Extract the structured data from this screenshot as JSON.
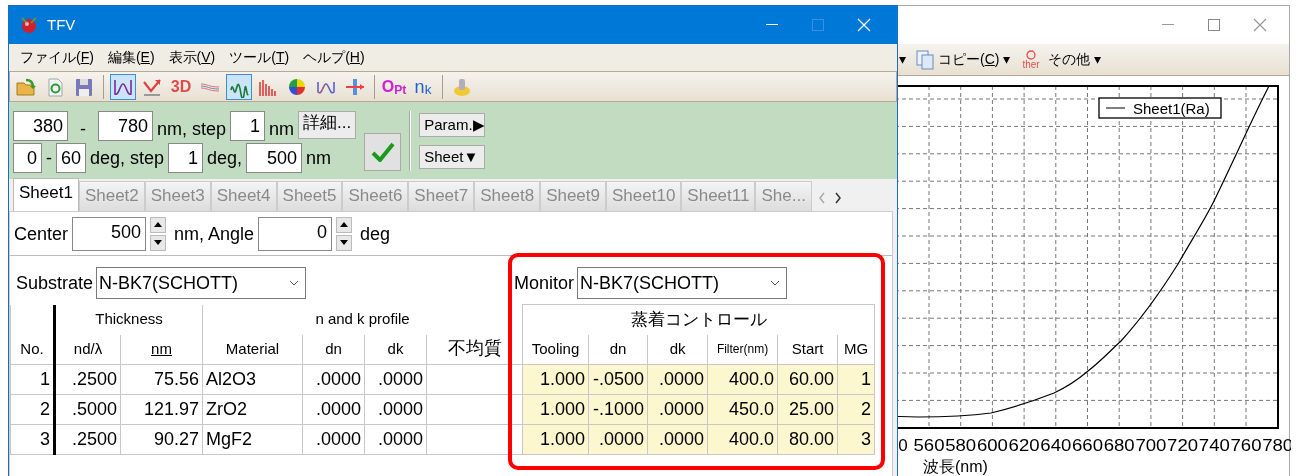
{
  "window": {
    "title": "TFV"
  },
  "menu": [
    {
      "label": "ファイル(F)"
    },
    {
      "label": "編集(E)"
    },
    {
      "label": "表示(V)"
    },
    {
      "label": "ツール(T)"
    },
    {
      "label": "ヘルプ(H)"
    }
  ],
  "toolbar": [
    {
      "kind": "open",
      "pressed": false
    },
    {
      "kind": "reload",
      "pressed": false
    },
    {
      "kind": "save",
      "pressed": false
    },
    {
      "kind": "separator"
    },
    {
      "kind": "wave",
      "pressed": true
    },
    {
      "kind": "arrow",
      "pressed": false
    },
    {
      "kind": "threed",
      "text": "3D",
      "pressed": false
    },
    {
      "kind": "lines",
      "pressed": false
    },
    {
      "kind": "spectrum",
      "pressed": true
    },
    {
      "kind": "bars",
      "pressed": false
    },
    {
      "kind": "colorwheel",
      "pressed": false
    },
    {
      "kind": "wave2",
      "pressed": false
    },
    {
      "kind": "split",
      "pressed": false
    },
    {
      "kind": "separator"
    },
    {
      "kind": "opt",
      "text": "O$_{Pt}$",
      "pressed": false
    },
    {
      "kind": "nk",
      "text": "n$_{k}$",
      "pressed": false
    },
    {
      "kind": "separator"
    },
    {
      "kind": "stamp",
      "pressed": false
    }
  ],
  "range": {
    "wl_from": "380",
    "wl_dash": "-",
    "wl_to": "780",
    "wl_step_label": "nm, step",
    "wl_step": "1",
    "wl_unit": "nm",
    "detail_button": "詳細...",
    "ang_from": "0",
    "ang_dash": "-",
    "ang_to": "60",
    "ang_step_label": "deg, step",
    "ang_step": "1",
    "ang_unit": "deg,",
    "ref_wl": "500",
    "ref_unit": "nm",
    "param_button": "Param.▶",
    "sheet_button": "Sheet▼"
  },
  "tabs": [
    {
      "label": "Sheet1",
      "selected": true
    },
    {
      "label": "Sheet2",
      "selected": false
    },
    {
      "label": "Sheet3",
      "selected": false
    },
    {
      "label": "Sheet4",
      "selected": false
    },
    {
      "label": "Sheet5",
      "selected": false
    },
    {
      "label": "Sheet6",
      "selected": false
    },
    {
      "label": "Sheet7",
      "selected": false
    },
    {
      "label": "Sheet8",
      "selected": false
    },
    {
      "label": "Sheet9",
      "selected": false
    },
    {
      "label": "Sheet10",
      "selected": false
    },
    {
      "label": "Sheet11",
      "selected": false
    },
    {
      "label": "She...",
      "selected": false
    }
  ],
  "center": {
    "label": "Center",
    "value": "500",
    "unit": "nm, Angle",
    "angle": "0",
    "angle_unit": "deg"
  },
  "substrate": {
    "label": "Substrate",
    "value": "N-BK7(SCHOTT)"
  },
  "monitor": {
    "label": "Monitor",
    "value": "N-BK7(SCHOTT)"
  },
  "layers": {
    "groups": [
      {
        "control": false,
        "columns": [
          {
            "label": "No.",
            "underline": false
          }
        ]
      },
      {
        "label": "Thickness",
        "control": false,
        "columns": [
          {
            "label": "nd/λ",
            "underline": false
          },
          {
            "label": "nm",
            "underline": true
          }
        ]
      },
      {
        "label": "n and k profile",
        "control": false,
        "columns": [
          {
            "label": "Material",
            "underline": false
          },
          {
            "label": "dn",
            "underline": false
          },
          {
            "label": "dk",
            "underline": false
          },
          {
            "label": "不均質",
            "underline": false
          }
        ]
      },
      {
        "label": "蒸着コントロール",
        "control": true,
        "columns": [
          {
            "label": "Tooling",
            "underline": false
          },
          {
            "label": "dn",
            "underline": false
          },
          {
            "label": "dk",
            "underline": false
          },
          {
            "label": "Filter(nm)",
            "underline": false
          },
          {
            "label": "Start",
            "underline": false
          },
          {
            "label": "MG",
            "underline": false
          }
        ]
      }
    ],
    "rows": [
      {
        "no": "1",
        "nd": ".2500",
        "nm": "75.56",
        "material": "Al2O3",
        "dn": ".0000",
        "dk": ".0000",
        "tooling": "1.000",
        "cdn": "-.0500",
        "cdk": ".0000",
        "filter": "400.0",
        "start": "60.00",
        "mg": "1"
      },
      {
        "no": "2",
        "nd": ".5000",
        "nm": "121.97",
        "material": "ZrO2",
        "dn": ".0000",
        "dk": ".0000",
        "tooling": "1.000",
        "cdn": "-.1000",
        "cdk": ".0000",
        "filter": "450.0",
        "start": "25.00",
        "mg": "2"
      },
      {
        "no": "3",
        "nd": ".2500",
        "nm": "90.27",
        "material": "MgF2",
        "dn": ".0000",
        "dk": ".0000",
        "tooling": "1.000",
        "cdn": ".0000",
        "cdk": ".0000",
        "filter": "400.0",
        "start": "80.00",
        "mg": "3"
      }
    ]
  },
  "graph_window": {
    "toolbar": [
      {
        "kind": "caret",
        "text": "▾"
      },
      {
        "kind": "copy",
        "label": "コピー(C)"
      },
      {
        "kind": "caret",
        "text": "▾"
      },
      {
        "kind": "other",
        "icon_text": "ther",
        "label": "その他"
      },
      {
        "kind": "caret",
        "text": "▾"
      }
    ],
    "legend": "Sheet1(Ra)",
    "x_tick_labels": [
      "0",
      "560",
      "580",
      "600",
      "620",
      "640",
      "660",
      "680",
      "700",
      "720",
      "740",
      "760",
      "780"
    ],
    "xlabel": "波長(nm)"
  }
}
